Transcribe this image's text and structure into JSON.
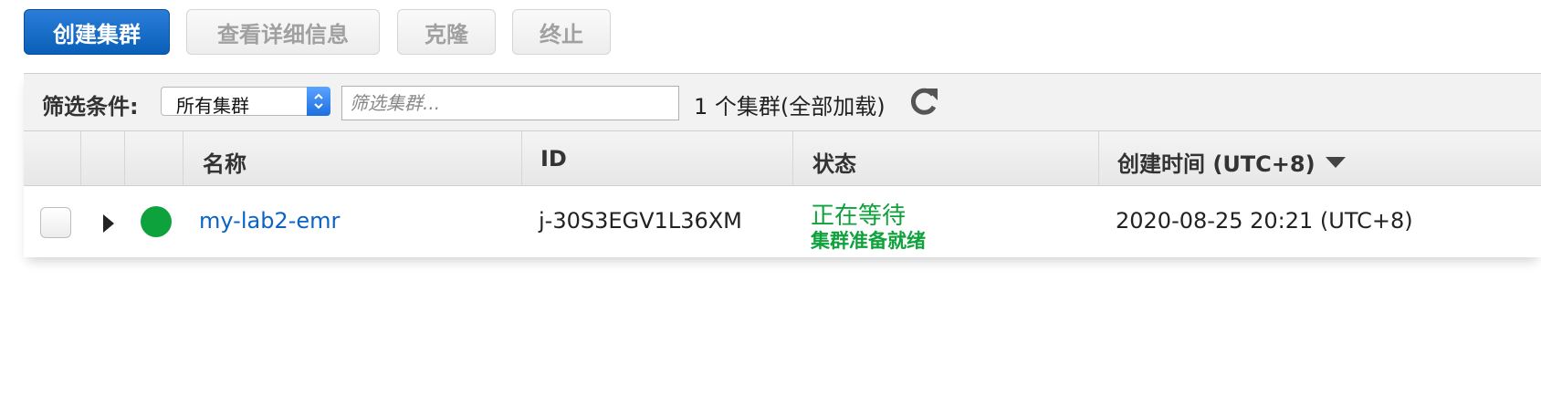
{
  "toolbar": {
    "create_label": "创建集群",
    "details_label": "查看详细信息",
    "clone_label": "克隆",
    "terminate_label": "终止"
  },
  "filter": {
    "label": "筛选条件:",
    "select_value": "所有集群",
    "search_placeholder": "筛选集群...",
    "count_text": "1 个集群(全部加载)"
  },
  "table": {
    "headers": {
      "name": "名称",
      "id": "ID",
      "status": "状态",
      "created": "创建时间 (UTC+8)"
    },
    "rows": [
      {
        "name": "my-lab2-emr",
        "id": "j-30S3EGV1L36XM",
        "status": "正在等待",
        "status_detail": "集群准备就绪",
        "created": "2020-08-25 20:21 (UTC+8)"
      }
    ]
  },
  "colors": {
    "primary": "#0a5fb8",
    "status_green": "#0da23b",
    "link": "#0b63c4"
  },
  "icons": {
    "refresh": "refresh-icon",
    "sort": "sort-down-icon",
    "expand": "expand-arrow-icon",
    "status": "status-dot-icon"
  }
}
